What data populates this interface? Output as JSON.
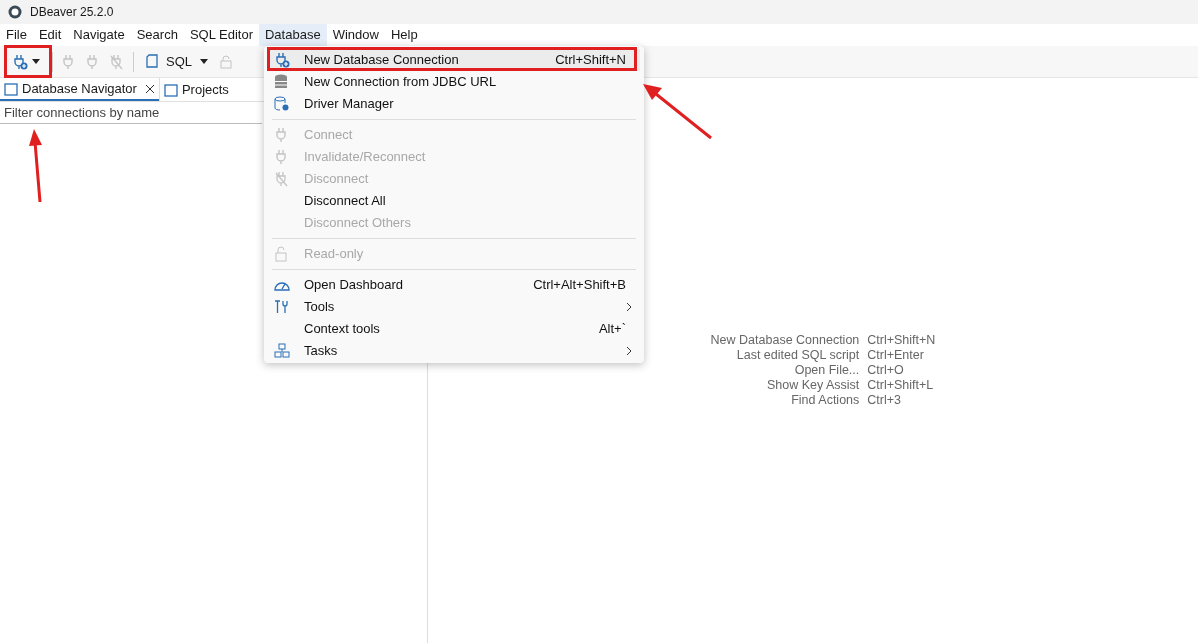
{
  "window": {
    "title": "DBeaver 25.2.0"
  },
  "menubar": [
    {
      "label": "File",
      "selected": false
    },
    {
      "label": "Edit",
      "selected": false
    },
    {
      "label": "Navigate",
      "selected": false
    },
    {
      "label": "Search",
      "selected": false
    },
    {
      "label": "SQL Editor",
      "selected": false
    },
    {
      "label": "Database",
      "selected": true
    },
    {
      "label": "Window",
      "selected": false
    },
    {
      "label": "Help",
      "selected": false
    }
  ],
  "toolbar": {
    "sql_label": "SQL"
  },
  "tabs": [
    {
      "label": "Database Navigator",
      "selected": true,
      "closable": true
    },
    {
      "label": "Projects",
      "selected": false,
      "closable": false
    }
  ],
  "filter": {
    "placeholder": "Filter connections by name"
  },
  "menu": [
    {
      "kind": "item",
      "label": "New Database Connection",
      "shortcut": "Ctrl+Shift+N",
      "disabled": false,
      "submenu": false,
      "selected": true
    },
    {
      "kind": "item",
      "label": "New Connection from JDBC URL",
      "disabled": false,
      "submenu": false,
      "selected": false
    },
    {
      "kind": "item",
      "label": "Driver Manager",
      "disabled": false,
      "submenu": false,
      "selected": false
    },
    {
      "kind": "separator"
    },
    {
      "kind": "item",
      "label": "Connect",
      "disabled": true,
      "submenu": false,
      "selected": false
    },
    {
      "kind": "item",
      "label": "Invalidate/Reconnect",
      "disabled": true,
      "submenu": false,
      "selected": false
    },
    {
      "kind": "item",
      "label": "Disconnect",
      "disabled": true,
      "submenu": false,
      "selected": false
    },
    {
      "kind": "item",
      "label": "Disconnect All",
      "disabled": false,
      "submenu": false,
      "selected": false
    },
    {
      "kind": "item",
      "label": "Disconnect Others",
      "disabled": true,
      "submenu": false,
      "selected": false
    },
    {
      "kind": "separator"
    },
    {
      "kind": "item",
      "label": "Read-only",
      "disabled": true,
      "submenu": false,
      "selected": false
    },
    {
      "kind": "separator"
    },
    {
      "kind": "item",
      "label": "Open Dashboard",
      "shortcut": "Ctrl+Alt+Shift+B",
      "disabled": false,
      "submenu": false,
      "selected": false
    },
    {
      "kind": "item",
      "label": "Tools",
      "disabled": false,
      "submenu": true,
      "selected": false
    },
    {
      "kind": "item",
      "label": "Context tools",
      "shortcut": "Alt+`",
      "disabled": false,
      "submenu": false,
      "selected": false
    },
    {
      "kind": "item",
      "label": "Tasks",
      "disabled": false,
      "submenu": true,
      "selected": false
    }
  ],
  "hints": [
    {
      "action": "New Database Connection",
      "keys": "Ctrl+Shift+N"
    },
    {
      "action": "Last edited SQL script",
      "keys": "Ctrl+Enter"
    },
    {
      "action": "Open File...",
      "keys": "Ctrl+O"
    },
    {
      "action": "Show Key Assist",
      "keys": "Ctrl+Shift+L"
    },
    {
      "action": "Find Actions",
      "keys": "Ctrl+3"
    }
  ]
}
